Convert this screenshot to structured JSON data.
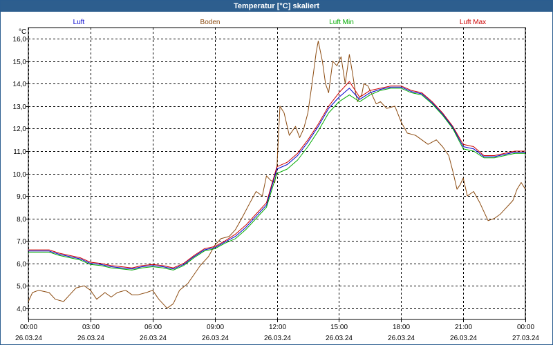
{
  "window": {
    "title": "Temperatur [°C] skaliert"
  },
  "chart_data": {
    "type": "line",
    "title": "Temperatur [°C] skaliert",
    "ylabel": "°C",
    "ylim": [
      3.5,
      16.5
    ],
    "yticks": [
      "4,0",
      "5,0",
      "6,0",
      "7,0",
      "8,0",
      "9,0",
      "10,0",
      "11,0",
      "12,0",
      "13,0",
      "14,0",
      "15,0",
      "16,0"
    ],
    "ytick_values": [
      4,
      5,
      6,
      7,
      8,
      9,
      10,
      11,
      12,
      13,
      14,
      15,
      16
    ],
    "xlim": [
      0,
      24
    ],
    "xticks": [
      {
        "value": 0,
        "time": "00:00",
        "date": "26.03.24"
      },
      {
        "value": 3,
        "time": "03:00",
        "date": "26.03.24"
      },
      {
        "value": 6,
        "time": "06:00",
        "date": "26.03.24"
      },
      {
        "value": 9,
        "time": "09:00",
        "date": "26.03.24"
      },
      {
        "value": 12,
        "time": "12:00",
        "date": "26.03.24"
      },
      {
        "value": 15,
        "time": "15:00",
        "date": "26.03.24"
      },
      {
        "value": 18,
        "time": "18:00",
        "date": "26.03.24"
      },
      {
        "value": 21,
        "time": "21:00",
        "date": "26.03.24"
      },
      {
        "value": 24,
        "time": "00:00",
        "date": "27.03.24"
      }
    ],
    "grid": true,
    "legend_position": "top",
    "series": [
      {
        "name": "Boden",
        "color": "#8b4a0f",
        "x": [
          0,
          0.2,
          0.5,
          1,
          1.3,
          1.7,
          2,
          2.3,
          2.7,
          3,
          3.3,
          3.7,
          4,
          4.3,
          4.7,
          5,
          5.3,
          5.7,
          6,
          6.3,
          6.7,
          7,
          7.3,
          7.7,
          8,
          8.3,
          8.7,
          9,
          9.3,
          9.7,
          10,
          10.3,
          10.7,
          11,
          11.3,
          11.5,
          11.7,
          11.9,
          12,
          12.15,
          12.35,
          12.6,
          12.9,
          13.1,
          13.3,
          13.5,
          13.7,
          13.9,
          14,
          14.2,
          14.35,
          14.5,
          14.7,
          14.9,
          15.1,
          15.3,
          15.5,
          15.65,
          15.8,
          15.9,
          16,
          16.1,
          16.2,
          16.4,
          16.6,
          16.8,
          17,
          17.3,
          17.7,
          18,
          18.3,
          18.7,
          19,
          19.3,
          19.7,
          20,
          20.3,
          20.5,
          20.7,
          20.85,
          21,
          21.2,
          21.5,
          21.8,
          22,
          22.2,
          22.5,
          22.8,
          23,
          23.2,
          23.4,
          23.6,
          23.8,
          24
        ],
        "values": [
          4.3,
          4.7,
          4.8,
          4.7,
          4.4,
          4.3,
          4.6,
          4.9,
          5.0,
          4.8,
          4.4,
          4.7,
          4.5,
          4.7,
          4.8,
          4.6,
          4.6,
          4.7,
          4.8,
          4.4,
          4.0,
          4.2,
          4.8,
          5.1,
          5.5,
          5.9,
          6.3,
          6.8,
          7.1,
          7.2,
          7.5,
          8.0,
          8.7,
          9.2,
          9.0,
          9.9,
          9.7,
          9.6,
          10.2,
          13.0,
          12.7,
          11.7,
          12.1,
          11.6,
          12.0,
          12.7,
          14.0,
          15.4,
          15.9,
          15.0,
          14.0,
          13.6,
          15.0,
          14.8,
          15.2,
          14.0,
          15.3,
          14.5,
          13.6,
          13.2,
          13.4,
          13.5,
          14.0,
          13.9,
          13.5,
          13.1,
          13.2,
          12.9,
          13.0,
          12.3,
          11.8,
          11.7,
          11.5,
          11.3,
          11.5,
          11.2,
          10.8,
          10.1,
          9.3,
          9.5,
          9.8,
          9.0,
          9.2,
          8.7,
          8.3,
          7.9,
          8.0,
          8.2,
          8.4,
          8.6,
          8.8,
          9.3,
          9.6,
          9.3
        ]
      },
      {
        "name": "Luft Max",
        "color": "#cc0000",
        "x": [
          0,
          0.5,
          1,
          1.5,
          2,
          2.5,
          3,
          3.5,
          4,
          4.5,
          5,
          5.5,
          6,
          6.5,
          7,
          7.5,
          8,
          8.5,
          9,
          9.5,
          10,
          10.5,
          11,
          11.5,
          12,
          12.5,
          13,
          13.5,
          14,
          14.5,
          15,
          15.5,
          16,
          16.5,
          17,
          17.5,
          18,
          18.5,
          19,
          19.5,
          20,
          20.5,
          21,
          21.5,
          22,
          22.5,
          23,
          23.5,
          24
        ],
        "values": [
          6.6,
          6.6,
          6.6,
          6.45,
          6.35,
          6.25,
          6.05,
          6.0,
          5.9,
          5.85,
          5.8,
          5.9,
          5.95,
          5.9,
          5.8,
          6.0,
          6.35,
          6.65,
          6.75,
          7.0,
          7.3,
          7.7,
          8.2,
          8.7,
          10.3,
          10.5,
          10.9,
          11.5,
          12.2,
          13.0,
          13.6,
          14.1,
          13.4,
          13.7,
          13.8,
          13.9,
          13.9,
          13.7,
          13.6,
          13.2,
          12.7,
          12.1,
          11.3,
          11.2,
          10.8,
          10.8,
          10.9,
          11.0,
          11.0
        ]
      },
      {
        "name": "Luft",
        "color": "#0000cc",
        "x": [
          0,
          0.5,
          1,
          1.5,
          2,
          2.5,
          3,
          3.5,
          4,
          4.5,
          5,
          5.5,
          6,
          6.5,
          7,
          7.5,
          8,
          8.5,
          9,
          9.5,
          10,
          10.5,
          11,
          11.5,
          12,
          12.5,
          13,
          13.5,
          14,
          14.5,
          15,
          15.5,
          16,
          16.5,
          17,
          17.5,
          18,
          18.5,
          19,
          19.5,
          20,
          20.5,
          21,
          21.5,
          22,
          22.5,
          23,
          23.5,
          24
        ],
        "values": [
          6.55,
          6.55,
          6.55,
          6.4,
          6.3,
          6.2,
          6.0,
          5.95,
          5.85,
          5.8,
          5.75,
          5.85,
          5.9,
          5.85,
          5.75,
          5.95,
          6.3,
          6.6,
          6.7,
          6.95,
          7.2,
          7.6,
          8.1,
          8.6,
          10.2,
          10.4,
          10.8,
          11.4,
          12.1,
          12.9,
          13.4,
          13.8,
          13.3,
          13.6,
          13.75,
          13.85,
          13.85,
          13.65,
          13.55,
          13.15,
          12.65,
          12.05,
          11.2,
          11.1,
          10.75,
          10.75,
          10.85,
          10.95,
          10.95
        ]
      },
      {
        "name": "Luft Min",
        "color": "#00aa00",
        "x": [
          0,
          0.5,
          1,
          1.5,
          2,
          2.5,
          3,
          3.5,
          4,
          4.5,
          5,
          5.5,
          6,
          6.5,
          7,
          7.5,
          8,
          8.5,
          9,
          9.5,
          10,
          10.5,
          11,
          11.5,
          12,
          12.5,
          13,
          13.5,
          14,
          14.5,
          15,
          15.5,
          16,
          16.5,
          17,
          17.5,
          18,
          18.5,
          19,
          19.5,
          20,
          20.5,
          21,
          21.5,
          22,
          22.5,
          23,
          23.5,
          24
        ],
        "values": [
          6.5,
          6.5,
          6.5,
          6.35,
          6.25,
          6.15,
          5.95,
          5.9,
          5.8,
          5.75,
          5.7,
          5.8,
          5.85,
          5.8,
          5.7,
          5.9,
          6.25,
          6.55,
          6.65,
          6.9,
          7.1,
          7.5,
          8.0,
          8.5,
          10.0,
          10.2,
          10.6,
          11.2,
          11.9,
          12.7,
          13.2,
          13.5,
          13.2,
          13.5,
          13.7,
          13.8,
          13.8,
          13.6,
          13.5,
          13.1,
          12.6,
          12.0,
          11.1,
          11.0,
          10.7,
          10.7,
          10.8,
          10.9,
          10.9
        ]
      }
    ],
    "legend": [
      {
        "label": "Luft",
        "color": "#0000cc"
      },
      {
        "label": "Boden",
        "color": "#8b4a0f"
      },
      {
        "label": "Luft Min",
        "color": "#00aa00"
      },
      {
        "label": "Luft Max",
        "color": "#cc0000"
      }
    ]
  }
}
